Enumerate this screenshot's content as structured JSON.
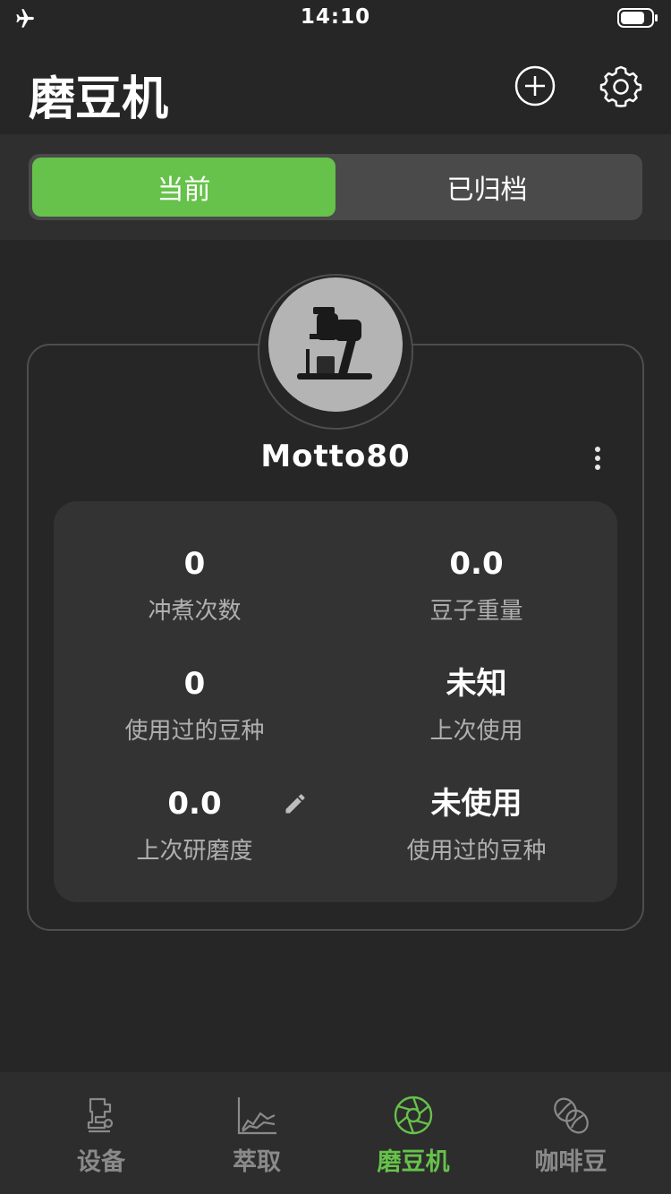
{
  "status_bar": {
    "time": "14:10",
    "icons": [
      "airplane-mode-icon",
      "battery-icon"
    ]
  },
  "header": {
    "title": "磨豆机",
    "icons": [
      "add-circle-icon",
      "gear-icon"
    ]
  },
  "segmented": {
    "tabs": [
      {
        "label": "当前",
        "active": true
      },
      {
        "label": "已归档",
        "active": false
      }
    ],
    "accent_color": "#66c24a"
  },
  "grinder": {
    "name": "Motto80",
    "avatar_icon": "grinder-image",
    "stats": [
      {
        "value": "0",
        "label": "冲煮次数"
      },
      {
        "value": "0.0",
        "label": "豆子重量"
      },
      {
        "value": "0",
        "label": "使用过的豆种"
      },
      {
        "value": "未知",
        "label": "上次使用"
      },
      {
        "value": "0.0",
        "label": "上次研磨度"
      },
      {
        "value": "未使用",
        "label": "使用过的豆种"
      }
    ]
  },
  "bottom_nav": {
    "items": [
      {
        "label": "设备",
        "icon": "device-icon",
        "active": false
      },
      {
        "label": "萃取",
        "icon": "chart-line-icon",
        "active": false
      },
      {
        "label": "磨豆机",
        "icon": "aperture-icon",
        "active": true
      },
      {
        "label": "咖啡豆",
        "icon": "coffee-bean-icon",
        "active": false
      }
    ]
  }
}
